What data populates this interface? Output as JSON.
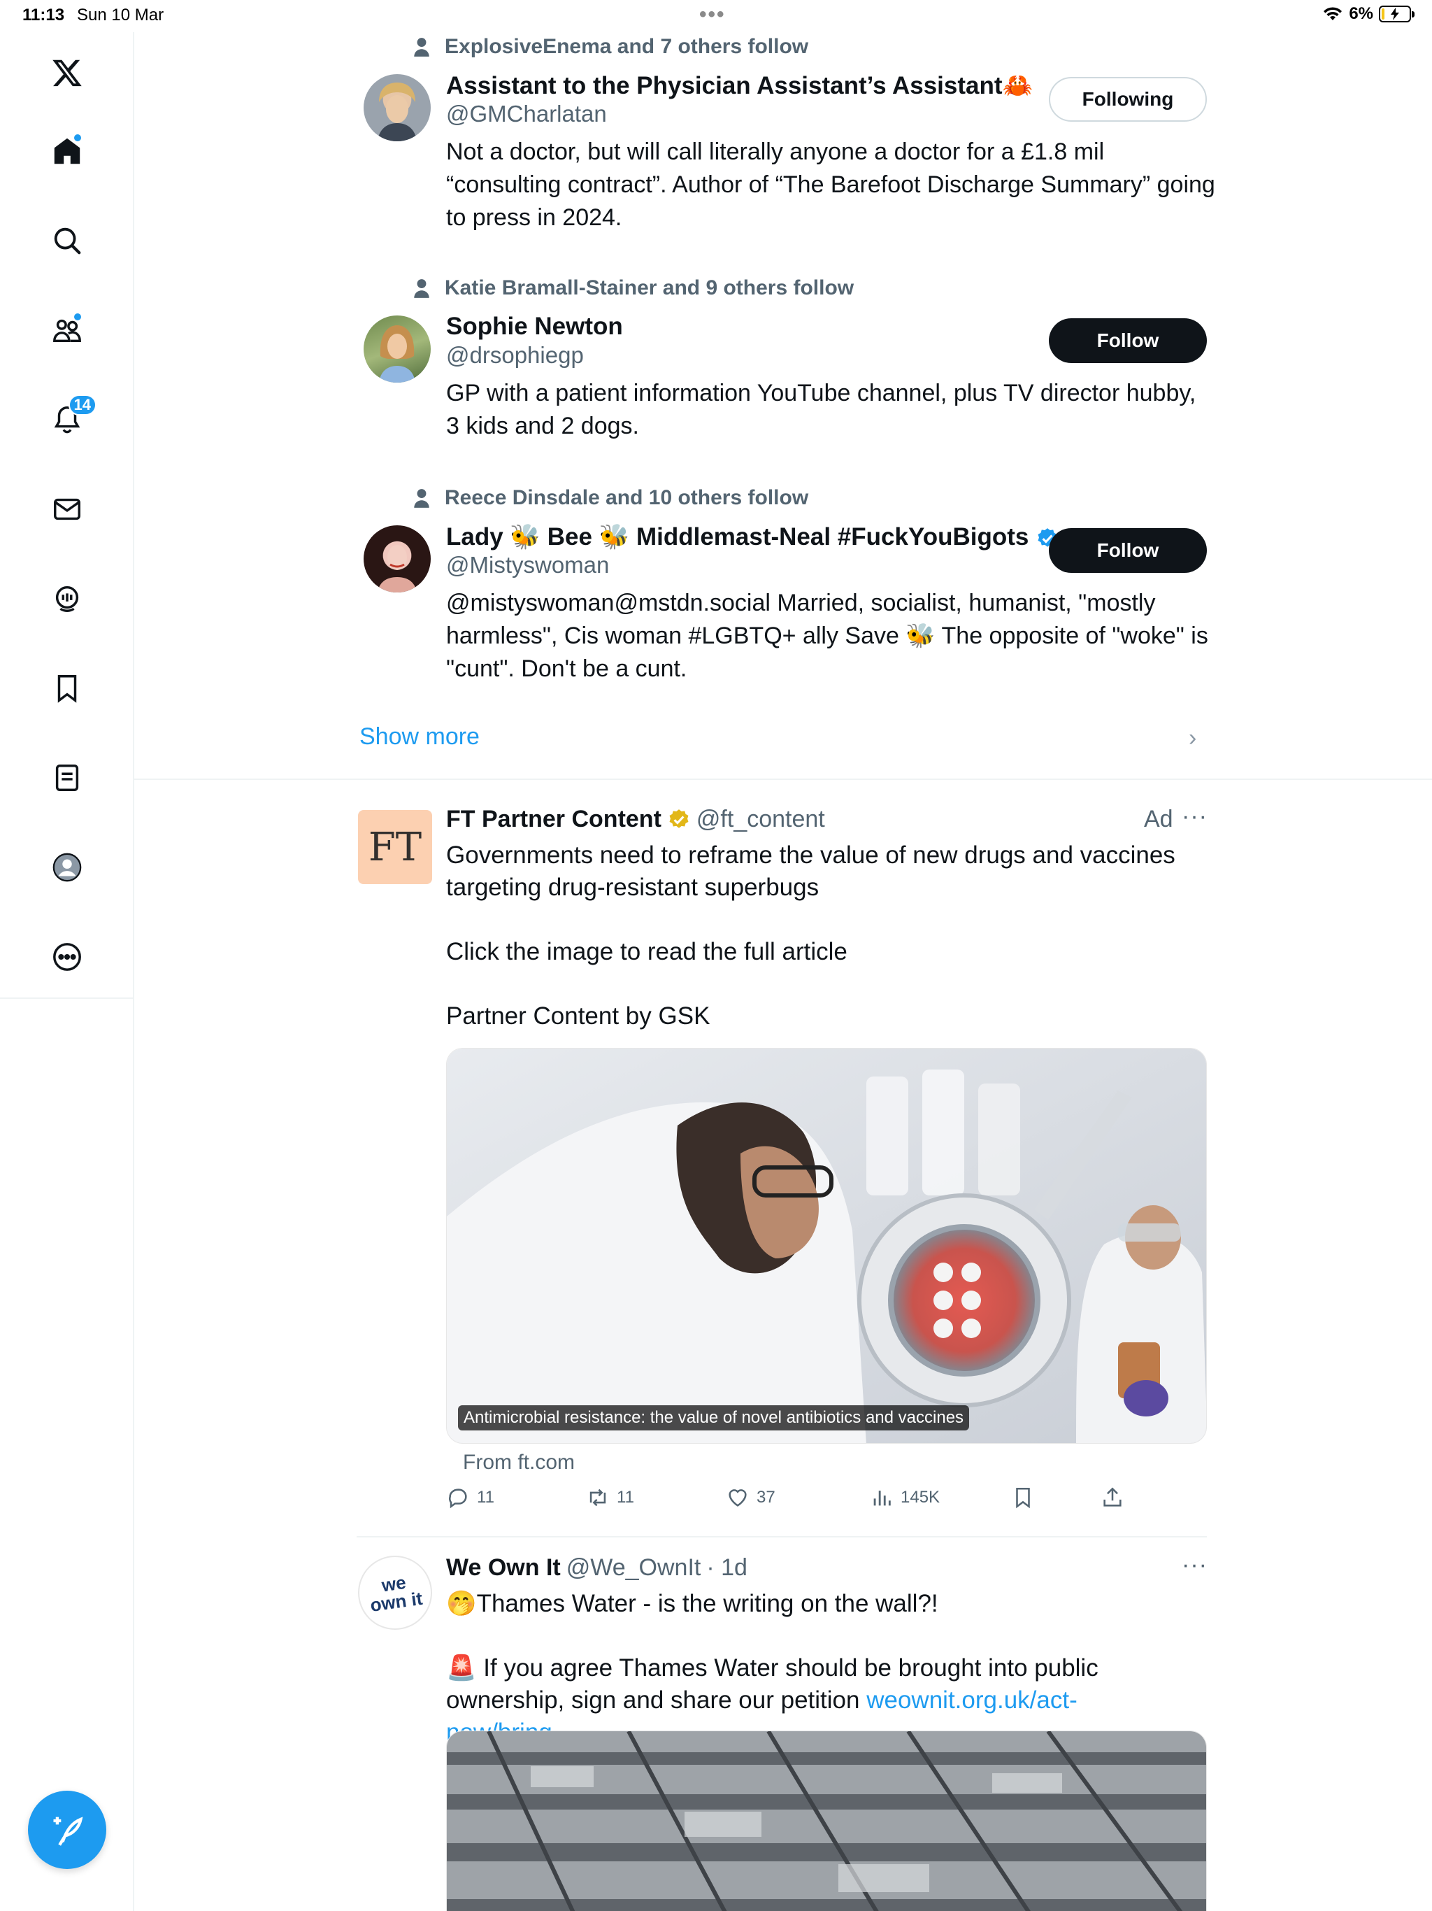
{
  "status_bar": {
    "time": "11:13",
    "date": "Sun 10 Mar",
    "battery": "6%"
  },
  "sidebar": {
    "notifications_count": "14",
    "items": [
      "logo",
      "home",
      "search",
      "communities",
      "notifications",
      "messages",
      "spaces",
      "bookmarks",
      "lists",
      "profile",
      "more"
    ]
  },
  "who_to_follow": [
    {
      "social_context": "ExplosiveEnema and 7 others follow",
      "name": "Assistant to the Physician Assistant’s Assistant🦀",
      "handle": "@GMCharlatan",
      "bio": "Not a doctor, but will call literally anyone a doctor for a £1.8 mil “consulting contract”. Author of “The Barefoot Discharge Summary” going to press in 2024.",
      "button": "Following"
    },
    {
      "social_context": "Katie Bramall-Stainer and 9 others follow",
      "name": "Sophie Newton",
      "handle": "@drsophiegp",
      "bio": "GP with a patient information YouTube channel, plus TV director hubby, 3 kids and 2 dogs.",
      "button": "Follow"
    },
    {
      "social_context": "Reece Dinsdale and 10 others follow",
      "name": "Lady 🐝 Bee 🐝 Middlemast-Neal #FuckYouBigots",
      "handle": "@Mistyswoman",
      "bio": "@mistyswoman@mstdn.social Married, socialist, humanist, \"mostly harmless\", Cis woman #LGBTQ+ ally Save 🐝 The opposite of \"woke\" is \"cunt\". Don't be a cunt.",
      "button": "Follow"
    }
  ],
  "show_more": "Show more",
  "ad_tweet": {
    "avatar_text": "FT",
    "name": "FT Partner Content",
    "handle": "@ft_content",
    "ad_label": "Ad",
    "text": "Governments need to reframe the value of new drugs and vaccines targeting drug-resistant superbugs\n\nClick the image to read the full article\n\nPartner Content by GSK",
    "media_caption": "Antimicrobial resistance: the value of novel antibiotics and vaccines",
    "from": "From ft.com",
    "replies": "11",
    "reposts": "11",
    "likes": "37",
    "views": "145K"
  },
  "tweet2": {
    "avatar_text": "we own it",
    "name": "We Own It",
    "handle": "@We_OwnIt",
    "time": "· 1d",
    "line1": "🤭Thames Water - is the writing on the wall?!",
    "line2": "🚨 If you agree Thames Water should be brought into public ownership, sign and share our petition ",
    "link": "weownit.org.uk/act-now/bring-..."
  },
  "colors": {
    "accent": "#1d9bf0",
    "text": "#0f1419",
    "secondary": "#536471",
    "ft_bg": "#fcd0b1",
    "verified_gold": "#e2b719"
  }
}
